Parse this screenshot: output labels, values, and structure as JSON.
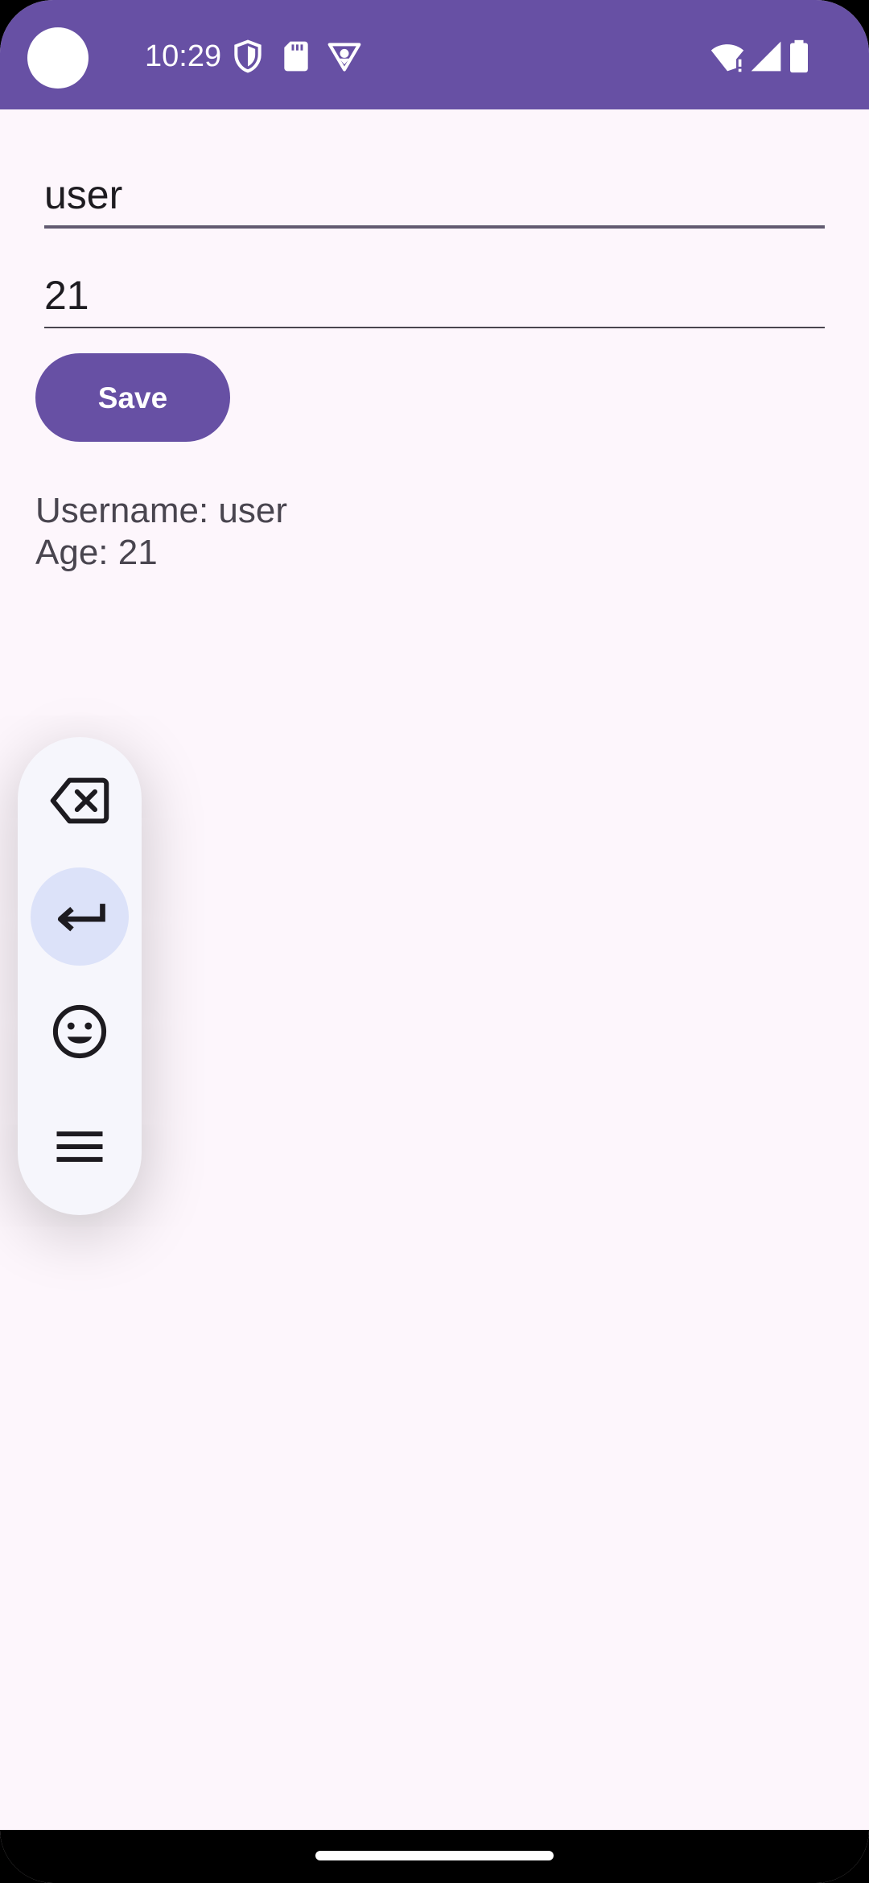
{
  "status_bar": {
    "time": "10:29",
    "background": "#6750A4",
    "icons": [
      "shield-icon",
      "sd-card-icon",
      "vpn-badge-icon",
      "wifi-alert-icon",
      "cell-signal-icon",
      "battery-icon"
    ]
  },
  "form": {
    "username_value": "user",
    "age_value": "21",
    "save_label": "Save"
  },
  "output": {
    "username_line": "Username: user",
    "age_line": "Age: 21"
  },
  "keyboard_toolbar": {
    "buttons": [
      "backspace-icon",
      "enter-icon",
      "emoji-icon",
      "menu-icon"
    ],
    "active": "enter-icon"
  },
  "colors": {
    "primary": "#6750A4",
    "surface": "#FDF6FC",
    "active_tool": "#DCE2F9"
  }
}
